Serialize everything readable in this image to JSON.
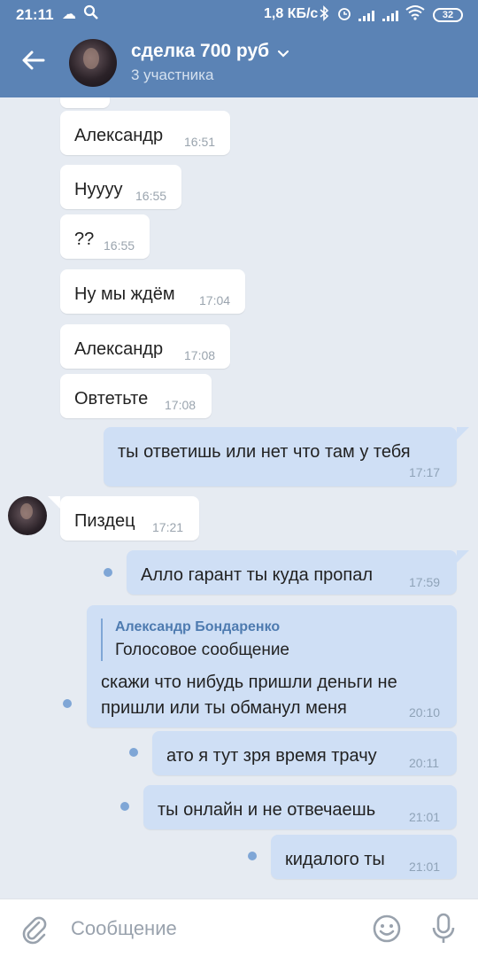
{
  "status_bar": {
    "time": "21:11",
    "net_speed": "1,8 КБ/с",
    "battery": "32",
    "icons": [
      "cloud-icon",
      "search-icon",
      "bluetooth-icon",
      "alarm-icon",
      "signal-icon",
      "signal-icon",
      "wifi-icon",
      "battery-icon"
    ]
  },
  "header": {
    "title": "сделка 700 руб",
    "subtitle": "3 участника",
    "accent_color": "#5b83b5"
  },
  "messages": [
    {
      "dir": "in",
      "text": "Александр",
      "time": "16:51"
    },
    {
      "dir": "in",
      "text": "Нуууу",
      "time": "16:55"
    },
    {
      "dir": "in",
      "text": "??",
      "time": "16:55"
    },
    {
      "dir": "in",
      "text": "Ну мы ждём",
      "time": "17:04"
    },
    {
      "dir": "in",
      "text": "Александр",
      "time": "17:08"
    },
    {
      "dir": "in",
      "text": "Овтетьте",
      "time": "17:08"
    },
    {
      "dir": "out",
      "text": "ты ответишь или нет что там у тебя",
      "time": "17:17"
    },
    {
      "dir": "in",
      "text": "Пиздец",
      "time": "17:21"
    },
    {
      "dir": "out",
      "text": "Алло гарант ты куда пропал",
      "time": "17:59"
    },
    {
      "dir": "out",
      "reply_name": "Александр Бондаренко",
      "reply_text": "Голосовое сообщение",
      "line1": "скажи что нибудь пришли деньги не",
      "line2": "пришли или ты обманул меня",
      "time": "20:10"
    },
    {
      "dir": "out",
      "text": "ато я тут зря время трачу",
      "time": "20:11"
    },
    {
      "dir": "out",
      "text": "ты онлайн и не отвечаешь",
      "time": "21:01"
    },
    {
      "dir": "out",
      "text": "кидалого ты",
      "time": "21:01"
    }
  ],
  "composer": {
    "placeholder": "Сообщение"
  }
}
